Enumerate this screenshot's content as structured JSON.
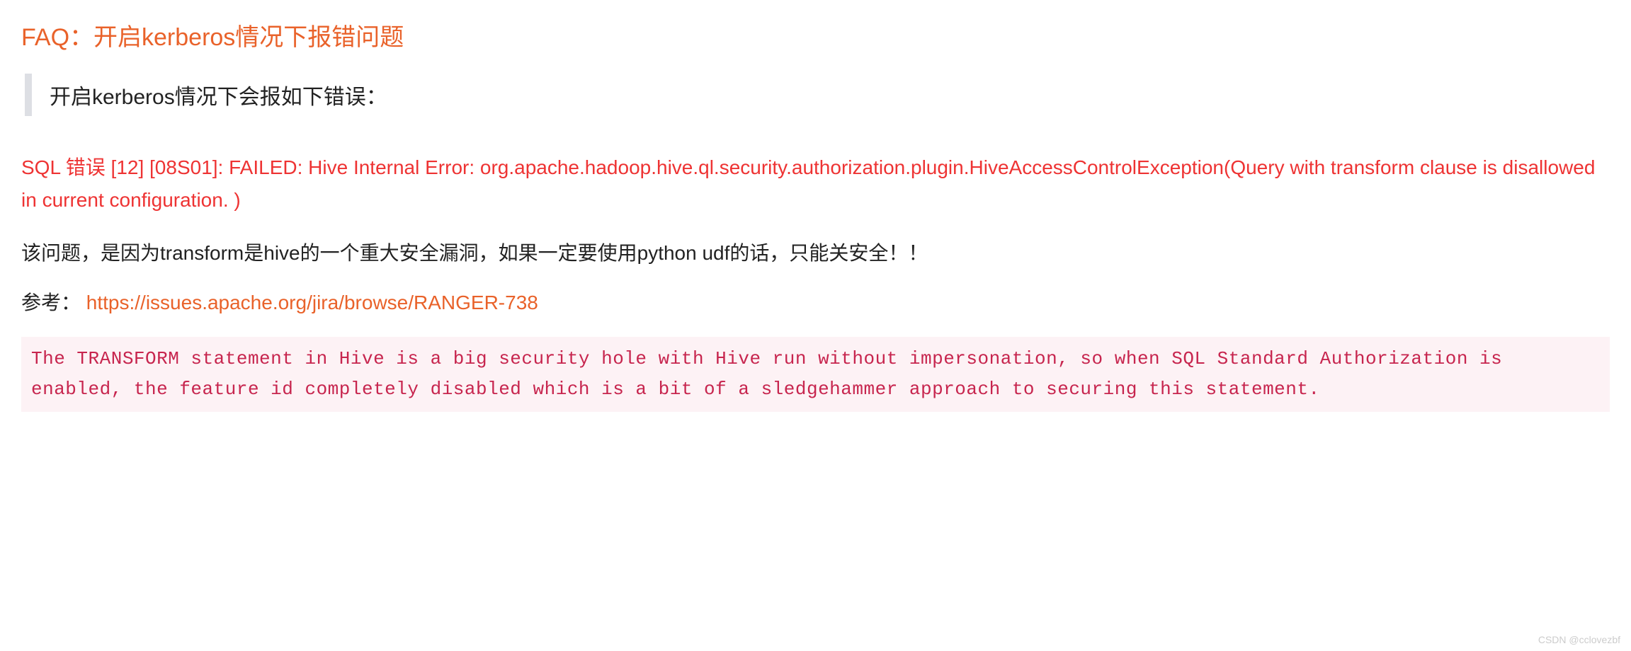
{
  "heading": "FAQ：开启kerberos情况下报错问题",
  "blockquote": "开启kerberos情况下会报如下错误：",
  "error_message": "SQL 错误 [12] [08S01]: FAILED: Hive Internal Error: org.apache.hadoop.hive.ql.security.authorization.plugin.HiveAccessControlException(Query with transform clause is disallowed in current configuration. )",
  "body_paragraph": "该问题，是因为transform是hive的一个重大安全漏洞，如果一定要使用python udf的话，只能关安全！！",
  "reference_label": "参考： ",
  "reference_link": "https://issues.apache.org/jira/browse/RANGER-738",
  "code_block": "The TRANSFORM statement in Hive is a big security hole with Hive run without impersonation, so when SQL Standard Authorization is enabled, the feature id completely disabled which is a bit of a sledgehammer approach to securing this statement.",
  "watermark": "CSDN @cclovezbf"
}
